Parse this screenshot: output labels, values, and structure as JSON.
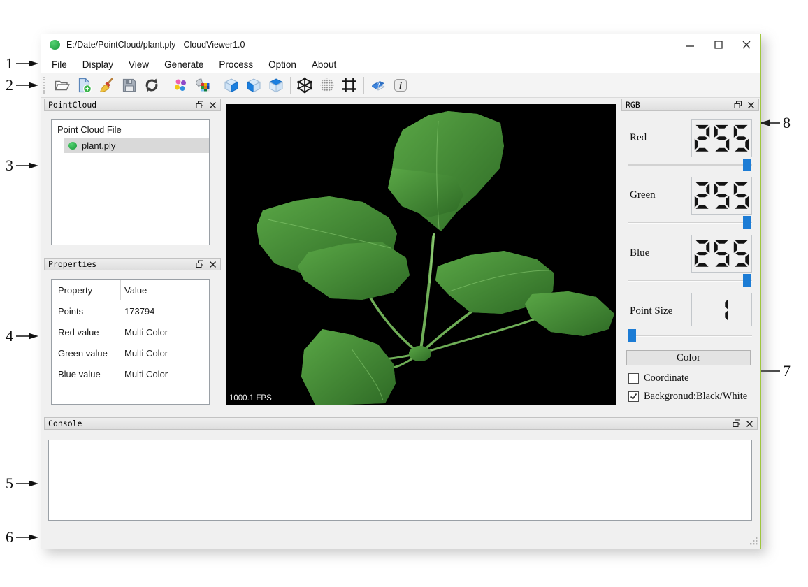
{
  "window": {
    "title": "E:/Date/PointCloud/plant.ply - CloudViewer1.0",
    "controls": [
      "minimize",
      "maximize",
      "close"
    ],
    "border_color": "#9fc63d"
  },
  "menu": {
    "items": [
      "File",
      "Display",
      "View",
      "Generate",
      "Process",
      "Option",
      "About"
    ]
  },
  "toolbar": {
    "icons": [
      "open-file",
      "new-file",
      "clean-broom",
      "save",
      "refresh",
      "point-colors",
      "color-fill",
      "cube-front-face",
      "cube-left-face",
      "cube-top-face",
      "wireframe-cube",
      "voxel-sphere",
      "crop-frame",
      "help-book",
      "about-info"
    ]
  },
  "docks": {
    "pointcloud": {
      "title": "PointCloud",
      "tree_header": "Point Cloud File",
      "items": [
        {
          "label": "plant.ply",
          "selected": true
        }
      ]
    },
    "properties": {
      "title": "Properties",
      "columns": [
        "Property",
        "Value"
      ],
      "rows": [
        [
          "Points",
          "173794"
        ],
        [
          "Red value",
          "Multi Color"
        ],
        [
          "Green value",
          "Multi Color"
        ],
        [
          "Blue value",
          "Multi Color"
        ]
      ]
    },
    "rgb": {
      "title": "RGB",
      "channels": [
        {
          "label": "Red",
          "value": 255
        },
        {
          "label": "Green",
          "value": 255
        },
        {
          "label": "Blue",
          "value": 255
        }
      ],
      "point_size": {
        "label": "Point Size",
        "value": 1
      },
      "color_button": "Color",
      "checkboxes": [
        {
          "label": "Coordinate",
          "checked": false
        },
        {
          "label": "Backgronud:Black/White",
          "checked": true
        }
      ]
    },
    "console": {
      "title": "Console",
      "content": ""
    }
  },
  "viewport": {
    "fps_label": "1000.1 FPS",
    "background": "#000000"
  },
  "annotations": [
    {
      "label": "1"
    },
    {
      "label": "2"
    },
    {
      "label": "3"
    },
    {
      "label": "4"
    },
    {
      "label": "5"
    },
    {
      "label": "6"
    },
    {
      "label": "7"
    },
    {
      "label": "8"
    }
  ],
  "colors": {
    "slider_handle": "#1c7cd5",
    "selection": "#d9d9d9",
    "app_icon_green": "#3cbd54",
    "plant_green_light": "#6fbe58",
    "plant_green_dark": "#2d5f24"
  }
}
